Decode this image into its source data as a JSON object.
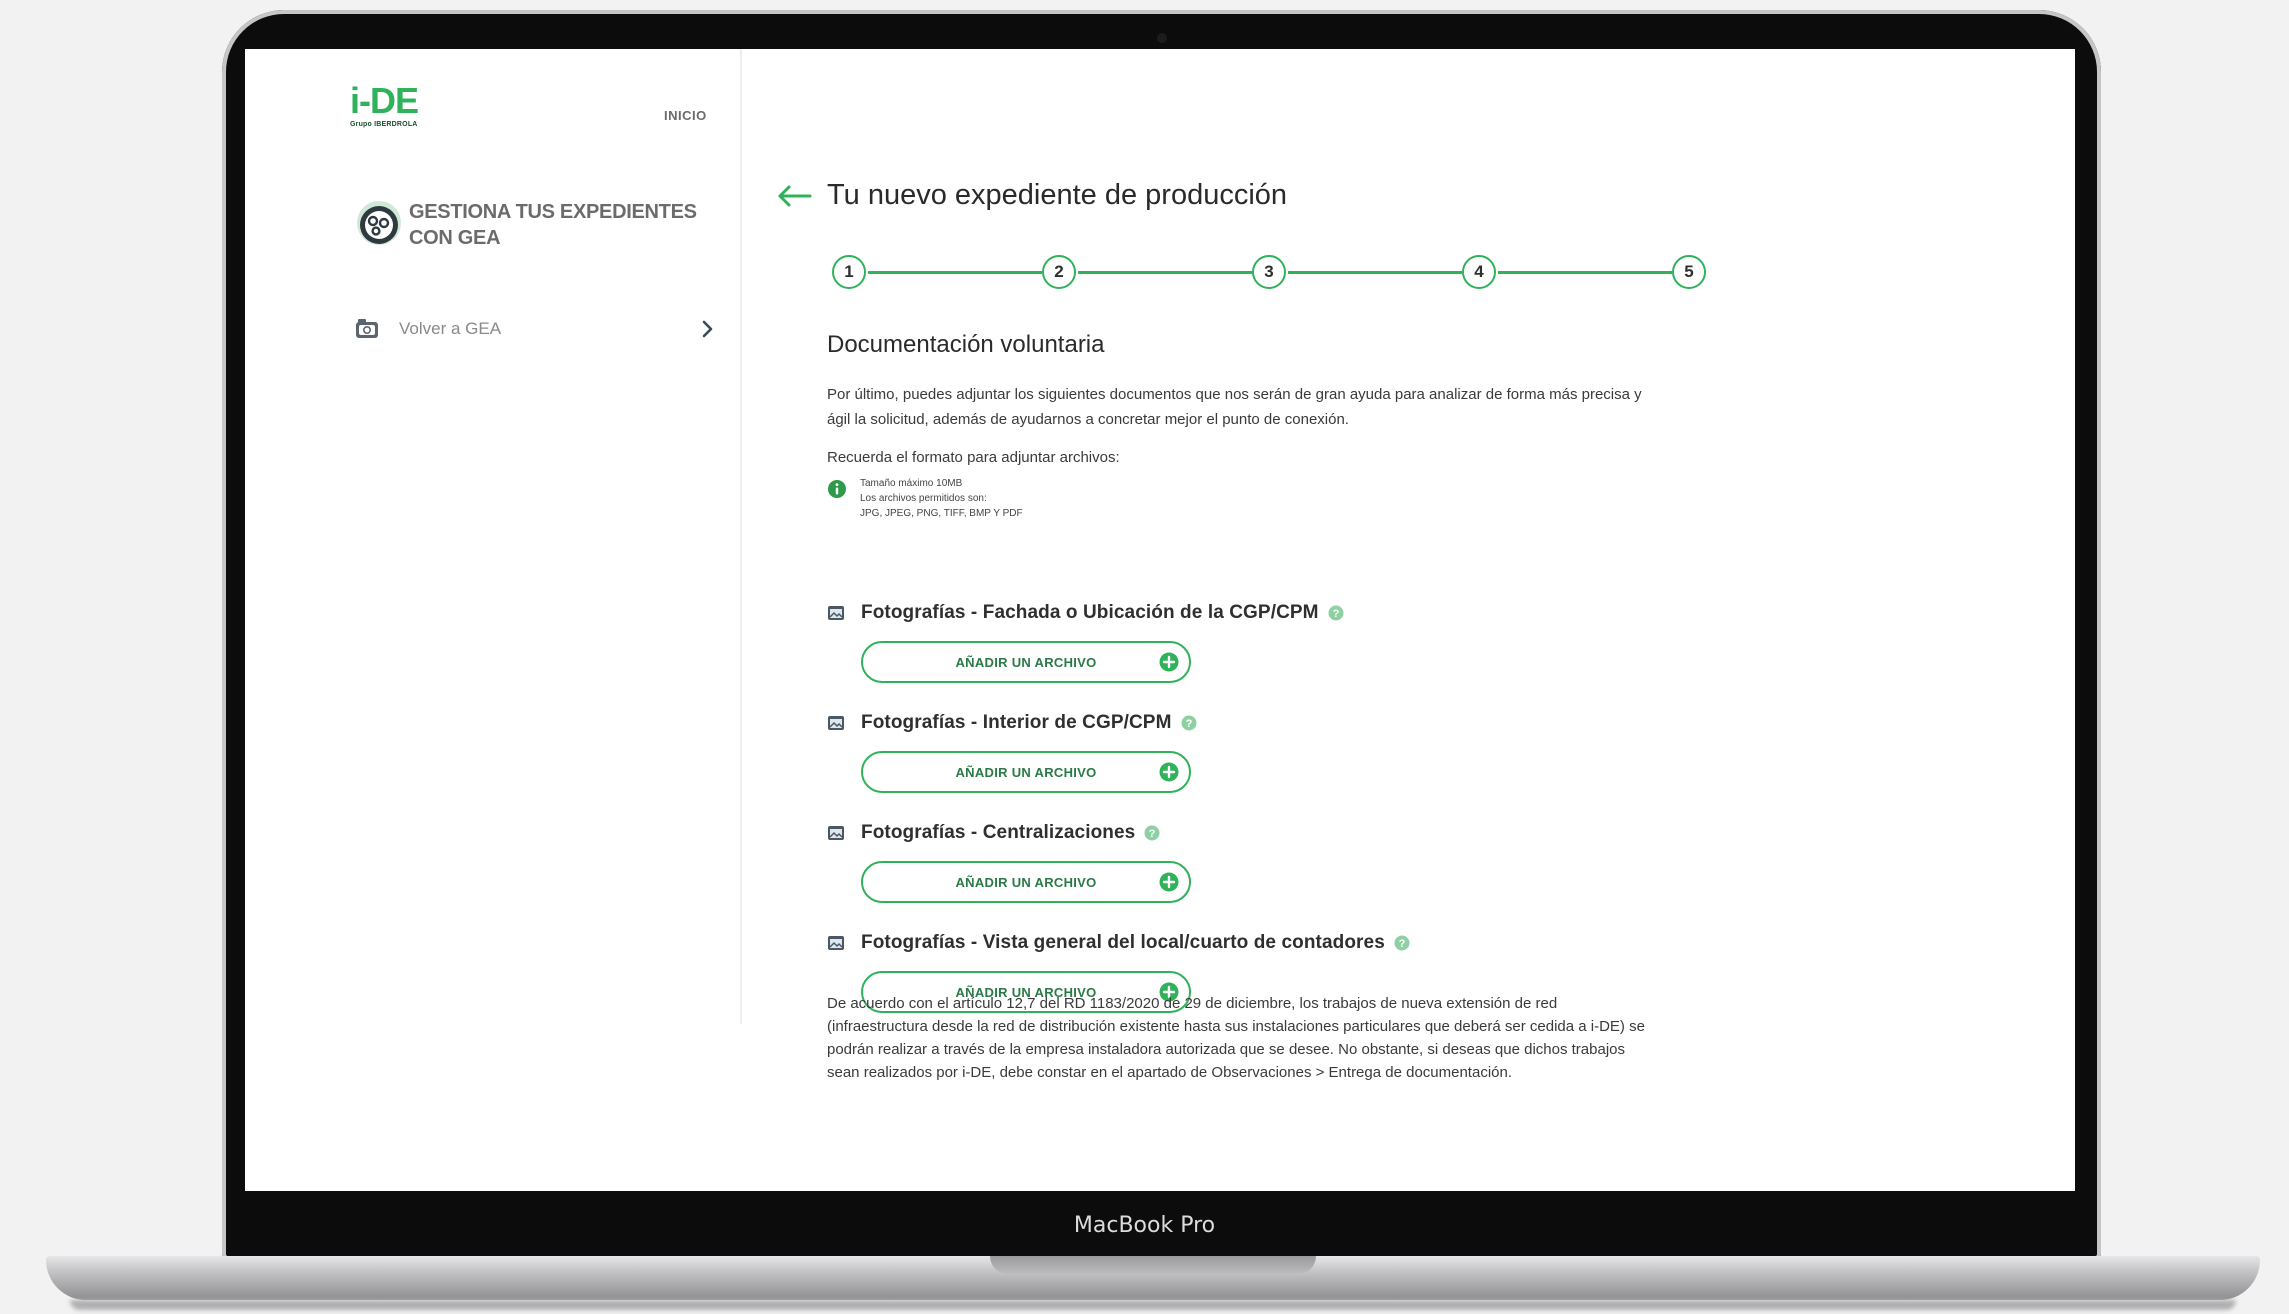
{
  "device": {
    "model_label": "MacBook Pro"
  },
  "sidebar": {
    "logo": {
      "brand": "i-DE",
      "sub": "Grupo IBERDROLA",
      "brand_color": "#2fb25a"
    },
    "nav_inicio": "INICIO",
    "gea_title_line1": "GESTIONA TUS EXPEDIENTES",
    "gea_title_line2": "CON GEA",
    "volver_label": "Volver a GEA"
  },
  "main": {
    "title": "Tu nuevo expediente de producción",
    "steps": [
      "1",
      "2",
      "3",
      "4",
      "5"
    ],
    "section_title": "Documentación voluntaria",
    "intro": "Por último, puedes adjuntar los siguientes documentos que nos serán de gran ayuda para analizar de forma más precisa y ágil la solicitud, además de ayudarnos a concretar mejor el punto de conexión.",
    "format": {
      "label": "Recuerda el formato para adjuntar archivos:",
      "note_size": "Tamaño máximo 10MB",
      "note_allowed": "Los archivos permitidos son:",
      "note_types": "JPG, JPEG, PNG, TIFF, BMP Y PDF"
    },
    "documents": [
      {
        "title": "Fotografías - Fachada o Ubicación de la CGP/CPM",
        "button": "AÑADIR UN ARCHIVO"
      },
      {
        "title": "Fotografías - Interior de CGP/CPM",
        "button": "AÑADIR UN ARCHIVO"
      },
      {
        "title": "Fotografías - Centralizaciones",
        "button": "AÑADIR UN ARCHIVO"
      },
      {
        "title": "Fotografías - Vista general del local/cuarto de contadores",
        "button": "AÑADIR UN ARCHIVO"
      }
    ],
    "footer_note": "De acuerdo con el artículo 12,7 del RD 1183/2020 de 29 de diciembre, los trabajos de nueva extensión de red (infraestructura desde la red de distribución existente hasta sus instalaciones particulares que deberá ser cedida a i-DE) se podrán realizar a través de la empresa instaladora autorizada que se desee. No obstante, si deseas que dichos trabajos sean realizados por i-DE, debe constar en el apartado de Observaciones > Entrega de documentación."
  },
  "colors": {
    "accent": "#2fb25a",
    "text": "#2a2a2a"
  }
}
